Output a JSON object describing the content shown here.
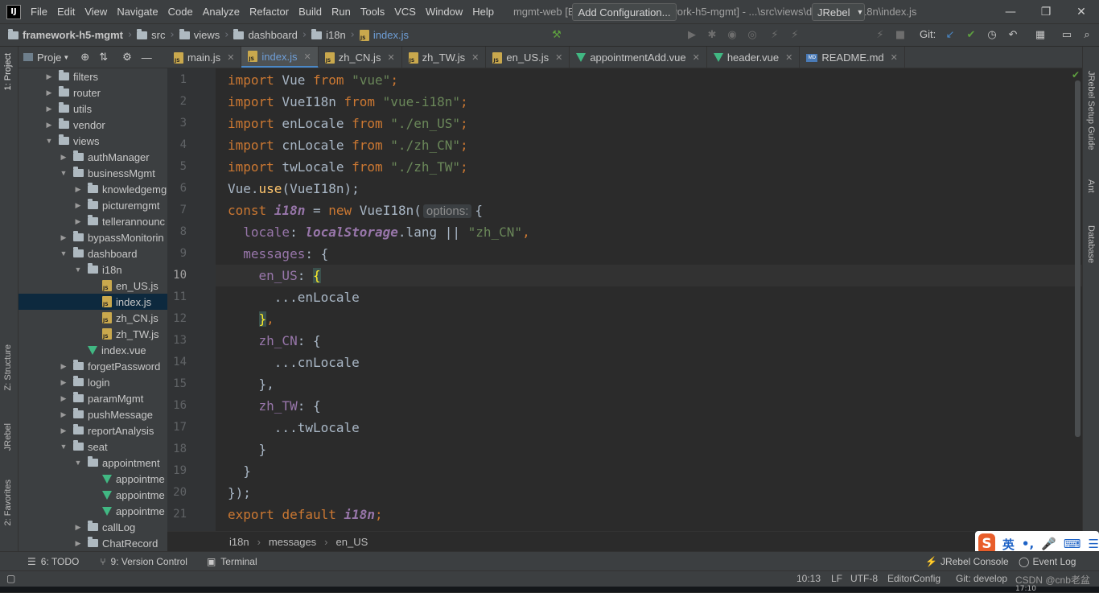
{
  "menubar": {
    "items": [
      "File",
      "Edit",
      "View",
      "Navigate",
      "Code",
      "Analyze",
      "Refactor",
      "Build",
      "Run",
      "Tools",
      "VCS",
      "Window",
      "Help"
    ],
    "window_title": "mgmt-web [E:\\Java\\Idea\\git\\framework-h5-mgmt] - ...\\src\\views\\dashboard\\i18n\\index.js",
    "logo_label": "IJ"
  },
  "navbar": {
    "crumbs": [
      "framework-h5-mgmt",
      "src",
      "views",
      "dashboard",
      "i18n",
      "index.js"
    ],
    "add_config": "Add Configuration...",
    "jrebel": "JRebel",
    "git_label": "Git:"
  },
  "left_strip": {
    "project": "1: Project",
    "structure": "Z: Structure",
    "jrebel": "JRebel",
    "favorites": "2: Favorites"
  },
  "right_strip": {
    "setup": "JRebel Setup Guide",
    "ant": "Ant",
    "database": "Database"
  },
  "project_panel": {
    "title": "Proje",
    "rows": [
      {
        "label": "filters",
        "type": "folder",
        "open": false
      },
      {
        "label": "router",
        "type": "folder",
        "open": false
      },
      {
        "label": "utils",
        "type": "folder",
        "open": false
      },
      {
        "label": "vendor",
        "type": "folder",
        "open": false
      },
      {
        "label": "views",
        "type": "folder",
        "open": true
      },
      {
        "label": "authManager",
        "type": "folder",
        "open": false
      },
      {
        "label": "businessMgmt",
        "type": "folder",
        "open": true
      },
      {
        "label": "knowledgemg",
        "type": "folder",
        "open": false
      },
      {
        "label": "picturemgmt",
        "type": "folder",
        "open": false
      },
      {
        "label": "tellerannounc",
        "type": "folder",
        "open": false
      },
      {
        "label": "bypassMonitorin",
        "type": "folder",
        "open": false
      },
      {
        "label": "dashboard",
        "type": "folder",
        "open": true
      },
      {
        "label": "i18n",
        "type": "folder",
        "open": true
      },
      {
        "label": "en_US.js",
        "type": "js"
      },
      {
        "label": "index.js",
        "type": "js"
      },
      {
        "label": "zh_CN.js",
        "type": "js"
      },
      {
        "label": "zh_TW.js",
        "type": "js"
      },
      {
        "label": "index.vue",
        "type": "vue"
      },
      {
        "label": "forgetPassword",
        "type": "folder",
        "open": false
      },
      {
        "label": "login",
        "type": "folder",
        "open": false
      },
      {
        "label": "paramMgmt",
        "type": "folder",
        "open": false
      },
      {
        "label": "pushMessage",
        "type": "folder",
        "open": false
      },
      {
        "label": "reportAnalysis",
        "type": "folder",
        "open": false
      },
      {
        "label": "seat",
        "type": "folder",
        "open": true
      },
      {
        "label": "appointment",
        "type": "folder",
        "open": true
      },
      {
        "label": "appointme",
        "type": "vue"
      },
      {
        "label": "appointme",
        "type": "vue"
      },
      {
        "label": "appointme",
        "type": "vue"
      },
      {
        "label": "callLog",
        "type": "folder",
        "open": false
      },
      {
        "label": "ChatRecord",
        "type": "folder",
        "open": false
      }
    ]
  },
  "tabs": [
    {
      "label": "main.js",
      "type": "js",
      "active": false
    },
    {
      "label": "index.js",
      "type": "js",
      "active": true
    },
    {
      "label": "zh_CN.js",
      "type": "js",
      "active": false
    },
    {
      "label": "zh_TW.js",
      "type": "js",
      "active": false
    },
    {
      "label": "en_US.js",
      "type": "js",
      "active": false
    },
    {
      "label": "appointmentAdd.vue",
      "type": "vue",
      "active": false
    },
    {
      "label": "header.vue",
      "type": "vue",
      "active": false
    },
    {
      "label": "README.md",
      "type": "md",
      "active": false
    }
  ],
  "editor": {
    "line_numbers": [
      "1",
      "2",
      "3",
      "4",
      "5",
      "6",
      "7",
      "8",
      "9",
      "10",
      "11",
      "12",
      "13",
      "14",
      "15",
      "16",
      "17",
      "18",
      "19",
      "20",
      "21"
    ],
    "current_line": "10",
    "code": {
      "l1": [
        "import",
        " Vue ",
        "from",
        " ",
        "\"vue\"",
        ";"
      ],
      "l2": [
        "import",
        " VueI18n ",
        "from",
        " ",
        "\"vue-i18n\"",
        ";"
      ],
      "l3": [
        "import",
        " enLocale ",
        "from",
        " ",
        "\"./en_US\"",
        ";"
      ],
      "l4": [
        "import",
        " cnLocale ",
        "from",
        " ",
        "\"./zh_CN\"",
        ";"
      ],
      "l5": [
        "import",
        " twLocale ",
        "from",
        " ",
        "\"./zh_TW\"",
        ";"
      ],
      "l6": [
        "Vue.",
        "use",
        "(VueI18n);"
      ],
      "l7": [
        "const",
        " ",
        "i18n",
        " = ",
        "new",
        " VueI18n(",
        "options:",
        "{"
      ],
      "l8": [
        "  ",
        "locale",
        ": ",
        "localStorage",
        ".lang || ",
        "\"zh_CN\"",
        ","
      ],
      "l9": [
        "  ",
        "messages",
        ": {"
      ],
      "l10": [
        "    ",
        "en_US",
        ": ",
        "{"
      ],
      "l11": [
        "      ...enLocale"
      ],
      "l12": [
        "    ",
        "}",
        ","
      ],
      "l13": [
        "    ",
        "zh_CN",
        ": {"
      ],
      "l14": [
        "      ...cnLocale"
      ],
      "l15": [
        "    },"
      ],
      "l16": [
        "    ",
        "zh_TW",
        ": {"
      ],
      "l17": [
        "      ...twLocale"
      ],
      "l18": [
        "    }"
      ],
      "l19": [
        "  }"
      ],
      "l20": [
        "});"
      ],
      "l21": [
        "export",
        " ",
        "default",
        " ",
        "i18n",
        ";"
      ]
    }
  },
  "breadcrumb": [
    "i18n",
    "messages",
    "en_US"
  ],
  "toolwindows": {
    "todo": "6: TODO",
    "vcs": "9: Version Control",
    "terminal": "Terminal",
    "jrebel_console": "JRebel Console",
    "event_log": "Event Log"
  },
  "status": {
    "pos": "10:13",
    "lf": "LF",
    "enc": "UTF-8",
    "editorconfig": "EditorConfig",
    "git": "Git: develop",
    "watermark": "CSDN @cnb老盆"
  },
  "ime": {
    "lang": "英",
    "punct": "•,",
    "mic": "🎤",
    "kbd": "⌨",
    "menu": "☰",
    "time": "17:10"
  },
  "colors": {
    "bg": "#2b2b2b",
    "panel": "#3c3f41",
    "keyword": "#cc7832",
    "string": "#6a8759",
    "property": "#9876aa",
    "accent": "#4a88c7"
  }
}
